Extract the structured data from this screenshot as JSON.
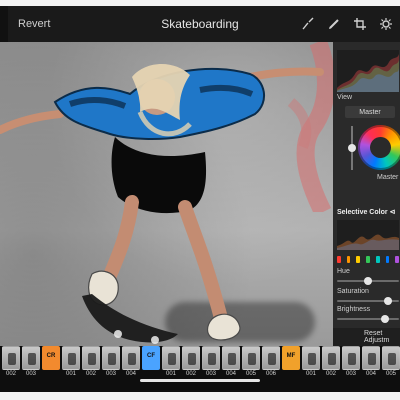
{
  "topbar": {
    "revert_label": "Revert",
    "title": "Skateboarding",
    "tool_icons": [
      "brush-icon",
      "pencil-icon",
      "crop-icon",
      "settings-icon"
    ]
  },
  "panel": {
    "view_label": "View",
    "master_pill": "Master",
    "wheel_label": "Master",
    "selective_color_label": "Selective Color",
    "selective_color_badge": "⊲",
    "hue_label": "Hue",
    "saturation_label": "Saturation",
    "brightness_label": "Brightness",
    "reset_label": "Reset Adjustm",
    "hue_level": 0.5,
    "saturation_level": 0.87,
    "brightness_level": 0.82,
    "wheel_level": 0.5,
    "swatch_colors": [
      "#ff3b30",
      "#ff9500",
      "#ffcc00",
      "#34c759",
      "#00c7be",
      "#007aff",
      "#af52de"
    ]
  },
  "filmstrip": {
    "thumbs": [
      {
        "kind": "photo",
        "caption": "002"
      },
      {
        "kind": "photo",
        "caption": "003"
      },
      {
        "kind": "tag",
        "text": "CR",
        "color": "#f28a2e",
        "caption": ""
      },
      {
        "kind": "photo",
        "caption": "001"
      },
      {
        "kind": "photo",
        "caption": "002"
      },
      {
        "kind": "photo",
        "caption": "003"
      },
      {
        "kind": "photo",
        "caption": "004"
      },
      {
        "kind": "tag",
        "text": "CF",
        "color": "#4aa3ff",
        "caption": ""
      },
      {
        "kind": "photo",
        "caption": "001"
      },
      {
        "kind": "photo",
        "caption": "002"
      },
      {
        "kind": "photo",
        "caption": "003"
      },
      {
        "kind": "photo",
        "caption": "004"
      },
      {
        "kind": "photo",
        "caption": "005"
      },
      {
        "kind": "photo",
        "caption": "006"
      },
      {
        "kind": "tag",
        "text": "MF",
        "color": "#f1a12b",
        "caption": ""
      },
      {
        "kind": "photo",
        "caption": "001"
      },
      {
        "kind": "photo",
        "caption": "002"
      },
      {
        "kind": "photo",
        "caption": "003"
      },
      {
        "kind": "photo",
        "caption": "004"
      },
      {
        "kind": "photo",
        "caption": "005"
      }
    ]
  }
}
